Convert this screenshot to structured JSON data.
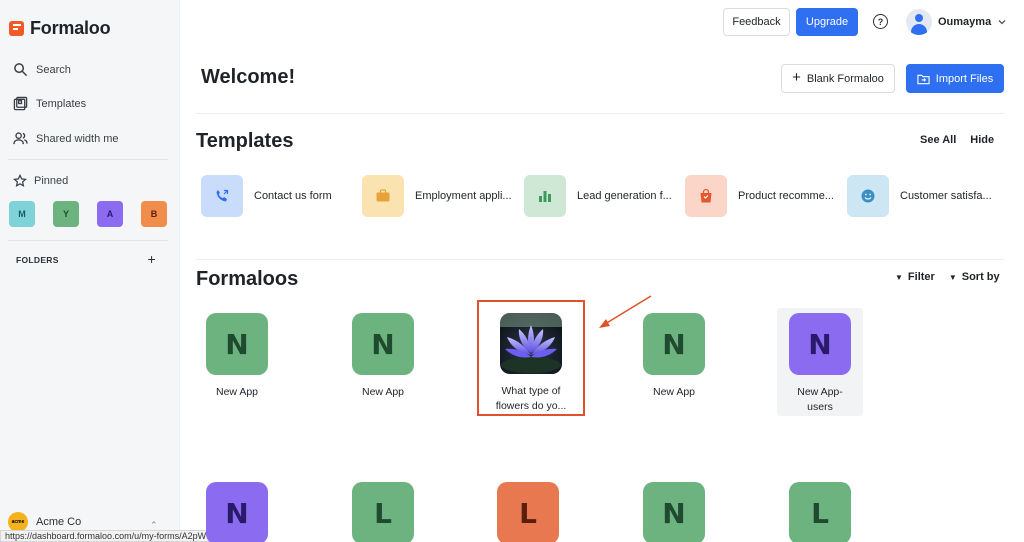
{
  "brand": {
    "name": "Formaloo"
  },
  "sidebar": {
    "nav": [
      {
        "label": "Search",
        "icon": "search-icon"
      },
      {
        "label": "Templates",
        "icon": "templates-icon"
      },
      {
        "label": "Shared width me",
        "icon": "users-icon"
      }
    ],
    "pinned_label": "Pinned",
    "pins": [
      {
        "letter": "M",
        "color": "#7dd3d8"
      },
      {
        "letter": "Y",
        "color": "#6db37f"
      },
      {
        "letter": "A",
        "color": "#8b6cf0"
      },
      {
        "letter": "B",
        "color": "#f08d4a"
      }
    ],
    "folders_label": "FOLDERS",
    "folders_add": "+",
    "workspace": {
      "name": "Acme Co",
      "avatar_text": "acme"
    }
  },
  "status_url": "https://dashboard.formaloo.com/u/my-forms/A2pWQCsV/app",
  "header": {
    "feedback_label": "Feedback",
    "upgrade_label": "Upgrade",
    "help_icon": "help-icon",
    "user_name": "Oumayma"
  },
  "welcome": {
    "title": "Welcome!",
    "blank_label": "Blank Formaloo",
    "import_label": "Import Files"
  },
  "templates": {
    "title": "Templates",
    "see_all": "See All",
    "hide": "Hide",
    "items": [
      {
        "label": "Contact us form",
        "icon": "phone-icon",
        "bg": "#c9dcfb",
        "fg": "#2f6ff1"
      },
      {
        "label": "Employment appli...",
        "icon": "briefcase-icon",
        "bg": "#fbe2b1",
        "fg": "#e9a23b"
      },
      {
        "label": "Lead generation f...",
        "icon": "bar-chart-icon",
        "bg": "#cfe8d6",
        "fg": "#3b9a5c"
      },
      {
        "label": "Product recomme...",
        "icon": "shopping-bag-icon",
        "bg": "#fbd6c8",
        "fg": "#e4572e"
      },
      {
        "label": "Customer satisfa...",
        "icon": "smile-icon",
        "bg": "#cde6f4",
        "fg": "#3a8fc4"
      }
    ]
  },
  "formaloos": {
    "title": "Formaloos",
    "filter_label": "Filter",
    "sort_label": "Sort by",
    "row1": [
      {
        "letter": "N",
        "label": "New App",
        "bg": "#6db37f",
        "fg": "#1f4a30"
      },
      {
        "letter": "N",
        "label": "New App",
        "bg": "#6db37f",
        "fg": "#1f4a30"
      },
      {
        "letter": "",
        "label": "What type of flowers do yo...",
        "image": "lotus-flower-image"
      },
      {
        "letter": "N",
        "label": "New App",
        "bg": "#6db37f",
        "fg": "#1f4a30"
      },
      {
        "letter": "N",
        "label": "New App-users",
        "bg": "#8b6cf0",
        "fg": "#2a1a6b"
      }
    ],
    "row2": [
      {
        "letter": "N",
        "bg": "#8b6cf0",
        "fg": "#2a1a6b"
      },
      {
        "letter": "L",
        "bg": "#6db37f",
        "fg": "#1f4a30"
      },
      {
        "letter": "L",
        "bg": "#e8784f",
        "fg": "#5a1f0a"
      },
      {
        "letter": "N",
        "bg": "#6db37f",
        "fg": "#1f4a30"
      },
      {
        "letter": "L",
        "bg": "#6db37f",
        "fg": "#1f4a30"
      }
    ]
  },
  "annotation": {
    "arrow_color": "#e0522b"
  }
}
